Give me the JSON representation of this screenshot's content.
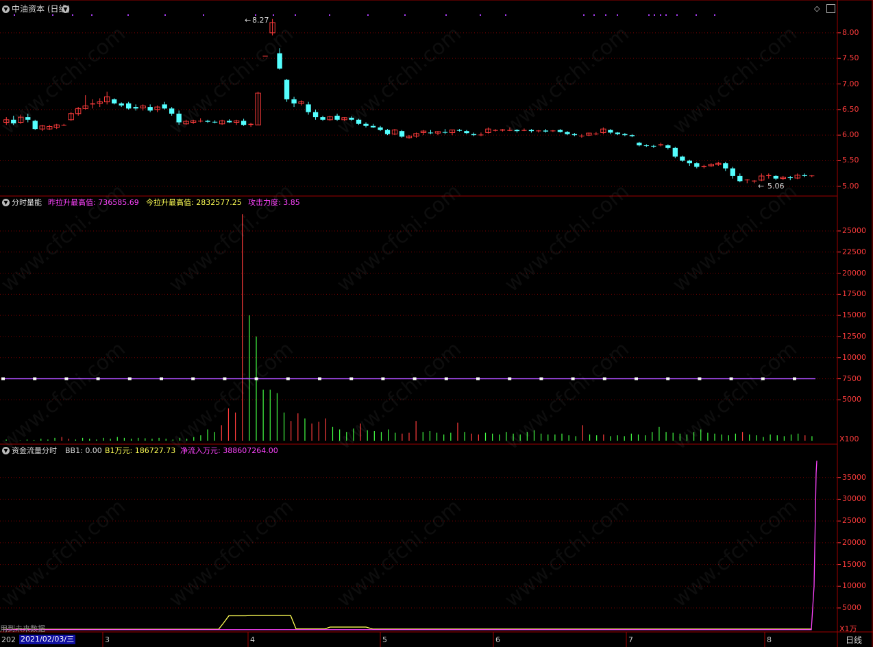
{
  "colors": {
    "up": "#ff3c3c",
    "down": "#54ffff",
    "grid": "#7a0000",
    "frame": "#a00000",
    "axis": "#ff3c3c",
    "magenta": "#ff44ff",
    "yellow": "#ffff55",
    "white": "#ffffff",
    "bg": "#000000"
  },
  "icons": {
    "menu": "chevron-down-icon",
    "diamond": "diamond-icon",
    "maximize": "maximize-icon"
  },
  "panel1": {
    "title": "中油资本 (日线)",
    "high_label": "8.27",
    "low_label": "5.06",
    "yticks": [
      "8.00",
      "7.50",
      "7.00",
      "6.50",
      "6.00",
      "5.50",
      "5.00"
    ]
  },
  "panel2": {
    "name": "分时量能",
    "f1_label": "昨拉升最高值:",
    "f1_value": "736585.69",
    "f2_label": "今拉升最高值:",
    "f2_value": "2832577.25",
    "f3_label": "攻击力度:",
    "f3_value": "3.85",
    "yticks": [
      "25000",
      "22500",
      "20000",
      "17500",
      "15000",
      "12500",
      "10000",
      "7500",
      "5000"
    ],
    "unit": "X100"
  },
  "panel3": {
    "name": "资金流量分时",
    "f1_label": "BB1:",
    "f1_value": "0.00",
    "f2_label": "B1万元:",
    "f2_value": "186727.73",
    "f3_label": "净流入万元:",
    "f3_value": "388607264.00",
    "note": "用到未来数据",
    "yticks": [
      "35000",
      "30000",
      "25000",
      "20000",
      "15000",
      "10000",
      "5000"
    ],
    "unit": "X1万"
  },
  "xaxis": {
    "left_stub": "202",
    "date": "2021/02/03/三",
    "months": [
      "3",
      "4",
      "5",
      "6",
      "7",
      "8"
    ],
    "period": "日线"
  },
  "watermark": "www.cfchi.com",
  "chart_data": [
    {
      "type": "candlestick",
      "title": "中油资本 (日线)",
      "ylim": [
        4.85,
        8.4
      ],
      "yticks": [
        5.0,
        5.5,
        6.0,
        6.5,
        7.0,
        7.5,
        8.0
      ],
      "annotations": [
        {
          "text": "8.27",
          "value": 8.27
        },
        {
          "text": "5.06",
          "value": 5.06
        }
      ],
      "ohlc": [
        [
          6.25,
          6.35,
          6.2,
          6.3
        ],
        [
          6.3,
          6.38,
          6.2,
          6.23
        ],
        [
          6.25,
          6.4,
          6.22,
          6.35
        ],
        [
          6.35,
          6.42,
          6.25,
          6.3
        ],
        [
          6.28,
          6.3,
          6.1,
          6.12
        ],
        [
          6.12,
          6.2,
          6.08,
          6.18
        ],
        [
          6.12,
          6.2,
          6.1,
          6.17
        ],
        [
          6.15,
          6.22,
          6.12,
          6.2
        ],
        [
          6.2,
          6.22,
          6.18,
          6.2
        ],
        [
          6.3,
          6.45,
          6.28,
          6.42
        ],
        [
          6.42,
          6.55,
          6.38,
          6.52
        ],
        [
          6.52,
          6.78,
          6.5,
          6.57
        ],
        [
          6.6,
          6.7,
          6.52,
          6.62
        ],
        [
          6.62,
          6.72,
          6.55,
          6.65
        ],
        [
          6.65,
          6.85,
          6.6,
          6.75
        ],
        [
          6.7,
          6.72,
          6.6,
          6.62
        ],
        [
          6.62,
          6.64,
          6.55,
          6.58
        ],
        [
          6.62,
          6.65,
          6.5,
          6.52
        ],
        [
          6.55,
          6.6,
          6.48,
          6.52
        ],
        [
          6.53,
          6.6,
          6.48,
          6.57
        ],
        [
          6.55,
          6.6,
          6.45,
          6.48
        ],
        [
          6.5,
          6.58,
          6.45,
          6.55
        ],
        [
          6.6,
          6.65,
          6.5,
          6.52
        ],
        [
          6.52,
          6.55,
          6.38,
          6.42
        ],
        [
          6.42,
          6.48,
          6.2,
          6.25
        ],
        [
          6.22,
          6.3,
          6.2,
          6.27
        ],
        [
          6.25,
          6.3,
          6.22,
          6.28
        ],
        [
          6.28,
          6.33,
          6.25,
          6.28
        ],
        [
          6.28,
          6.3,
          6.24,
          6.26
        ],
        [
          6.26,
          6.29,
          6.23,
          6.25
        ],
        [
          6.22,
          6.3,
          6.2,
          6.28
        ],
        [
          6.28,
          6.31,
          6.24,
          6.25
        ],
        [
          6.25,
          6.3,
          6.2,
          6.28
        ],
        [
          6.28,
          6.32,
          6.18,
          6.2
        ],
        [
          6.2,
          6.24,
          6.16,
          6.22
        ],
        [
          6.2,
          6.85,
          6.2,
          6.82
        ],
        [
          7.55,
          7.55,
          7.55,
          7.55
        ],
        [
          8.0,
          8.27,
          7.95,
          8.2
        ],
        [
          7.6,
          7.7,
          7.28,
          7.3
        ],
        [
          7.08,
          7.1,
          6.65,
          6.7
        ],
        [
          6.7,
          6.75,
          6.55,
          6.62
        ],
        [
          6.62,
          6.68,
          6.58,
          6.65
        ],
        [
          6.6,
          6.65,
          6.4,
          6.45
        ],
        [
          6.45,
          6.5,
          6.3,
          6.35
        ],
        [
          6.35,
          6.38,
          6.28,
          6.3
        ],
        [
          6.3,
          6.38,
          6.28,
          6.36
        ],
        [
          6.38,
          6.42,
          6.28,
          6.3
        ],
        [
          6.3,
          6.35,
          6.28,
          6.34
        ],
        [
          6.34,
          6.37,
          6.28,
          6.3
        ],
        [
          6.3,
          6.32,
          6.2,
          6.22
        ],
        [
          6.22,
          6.25,
          6.15,
          6.18
        ],
        [
          6.18,
          6.22,
          6.14,
          6.15
        ],
        [
          6.15,
          6.18,
          6.08,
          6.1
        ],
        [
          6.1,
          6.12,
          6.0,
          6.02
        ],
        [
          6.02,
          6.12,
          6.0,
          6.1
        ],
        [
          6.08,
          6.1,
          5.95,
          5.97
        ],
        [
          5.95,
          6.0,
          5.93,
          5.98
        ],
        [
          5.98,
          6.05,
          5.95,
          6.03
        ],
        [
          6.05,
          6.1,
          6.0,
          6.08
        ],
        [
          6.05,
          6.1,
          6.02,
          6.04
        ],
        [
          6.04,
          6.08,
          6.0,
          6.07
        ],
        [
          6.06,
          6.12,
          6.02,
          6.05
        ],
        [
          6.05,
          6.1,
          6.0,
          6.1
        ],
        [
          6.1,
          6.12,
          6.07,
          6.09
        ],
        [
          6.08,
          6.1,
          6.02,
          6.04
        ],
        [
          6.02,
          6.05,
          5.98,
          6.0
        ],
        [
          6.0,
          6.05,
          5.98,
          6.01
        ],
        [
          6.05,
          6.15,
          6.03,
          6.12
        ],
        [
          6.1,
          6.12,
          6.07,
          6.1
        ],
        [
          6.09,
          6.12,
          6.07,
          6.11
        ],
        [
          6.1,
          6.15,
          6.08,
          6.1
        ],
        [
          6.1,
          6.12,
          6.05,
          6.08
        ],
        [
          6.1,
          6.13,
          6.08,
          6.1
        ],
        [
          6.1,
          6.12,
          6.05,
          6.08
        ],
        [
          6.08,
          6.1,
          6.05,
          6.09
        ],
        [
          6.09,
          6.12,
          6.05,
          6.07
        ],
        [
          6.08,
          6.1,
          6.06,
          6.09
        ],
        [
          6.1,
          6.12,
          6.05,
          6.06
        ],
        [
          6.06,
          6.08,
          6.0,
          6.02
        ],
        [
          6.02,
          6.04,
          5.98,
          6.0
        ],
        [
          5.98,
          6.02,
          5.95,
          5.99
        ],
        [
          6.0,
          6.05,
          5.98,
          6.04
        ],
        [
          6.02,
          6.06,
          6.0,
          6.03
        ],
        [
          6.05,
          6.15,
          6.02,
          6.12
        ],
        [
          6.1,
          6.12,
          6.02,
          6.05
        ],
        [
          6.05,
          6.06,
          6.0,
          6.02
        ],
        [
          6.02,
          6.04,
          5.98,
          6.0
        ],
        [
          6.0,
          6.02,
          5.96,
          5.98
        ],
        [
          5.85,
          5.87,
          5.78,
          5.8
        ],
        [
          5.8,
          5.82,
          5.77,
          5.79
        ],
        [
          5.79,
          5.81,
          5.75,
          5.78
        ],
        [
          5.8,
          5.85,
          5.78,
          5.82
        ],
        [
          5.8,
          5.82,
          5.72,
          5.75
        ],
        [
          5.75,
          5.77,
          5.55,
          5.58
        ],
        [
          5.58,
          5.6,
          5.48,
          5.5
        ],
        [
          5.5,
          5.52,
          5.4,
          5.45
        ],
        [
          5.45,
          5.47,
          5.35,
          5.38
        ],
        [
          5.38,
          5.42,
          5.35,
          5.4
        ],
        [
          5.4,
          5.45,
          5.38,
          5.43
        ],
        [
          5.42,
          5.48,
          5.4,
          5.45
        ],
        [
          5.45,
          5.48,
          5.3,
          5.35
        ],
        [
          5.35,
          5.38,
          5.15,
          5.2
        ],
        [
          5.2,
          5.25,
          5.08,
          5.1
        ],
        [
          5.12,
          5.14,
          5.06,
          5.13
        ],
        [
          5.1,
          5.12,
          5.06,
          5.11
        ],
        [
          5.12,
          5.25,
          5.1,
          5.2
        ],
        [
          5.2,
          5.25,
          5.15,
          5.22
        ],
        [
          5.2,
          5.22,
          5.12,
          5.15
        ],
        [
          5.15,
          5.2,
          5.12,
          5.18
        ],
        [
          5.18,
          5.2,
          5.12,
          5.16
        ],
        [
          5.16,
          5.25,
          5.14,
          5.22
        ],
        [
          5.22,
          5.25,
          5.18,
          5.2
        ],
        [
          5.2,
          5.22,
          5.18,
          5.21
        ]
      ]
    },
    {
      "type": "bar",
      "title": "分时量能",
      "ylim": [
        0,
        28000
      ],
      "yticks": [
        5000,
        7500,
        10000,
        12500,
        15000,
        17500,
        20000,
        22500,
        25000
      ],
      "reference_line": 7500,
      "unit": "X100",
      "bars": [
        [
          300,
          "g"
        ],
        [
          150,
          "g"
        ],
        [
          200,
          "g"
        ],
        [
          300,
          "g"
        ],
        [
          250,
          "g"
        ],
        [
          400,
          "g"
        ],
        [
          300,
          "g"
        ],
        [
          500,
          "g"
        ],
        [
          600,
          "r"
        ],
        [
          400,
          "r"
        ],
        [
          300,
          "g"
        ],
        [
          500,
          "g"
        ],
        [
          400,
          "g"
        ],
        [
          300,
          "g"
        ],
        [
          500,
          "g"
        ],
        [
          400,
          "g"
        ],
        [
          600,
          "g"
        ],
        [
          500,
          "g"
        ],
        [
          400,
          "g"
        ],
        [
          500,
          "g"
        ],
        [
          450,
          "g"
        ],
        [
          400,
          "g"
        ],
        [
          500,
          "g"
        ],
        [
          400,
          "g"
        ],
        [
          300,
          "g"
        ],
        [
          500,
          "g"
        ],
        [
          400,
          "g"
        ],
        [
          600,
          "g"
        ],
        [
          800,
          "g"
        ],
        [
          1500,
          "g"
        ],
        [
          1200,
          "g"
        ],
        [
          2000,
          "r"
        ],
        [
          4000,
          "r"
        ],
        [
          3500,
          "r"
        ],
        [
          27000,
          "r"
        ],
        [
          15000,
          "g"
        ],
        [
          12500,
          "g"
        ],
        [
          6200,
          "g"
        ],
        [
          6200,
          "g"
        ],
        [
          5800,
          "g"
        ],
        [
          3500,
          "g"
        ],
        [
          2500,
          "r"
        ],
        [
          3400,
          "r"
        ],
        [
          2800,
          "g"
        ],
        [
          2200,
          "r"
        ],
        [
          2400,
          "r"
        ],
        [
          2800,
          "r"
        ],
        [
          1800,
          "g"
        ],
        [
          1500,
          "g"
        ],
        [
          1200,
          "g"
        ],
        [
          1600,
          "g"
        ],
        [
          2200,
          "r"
        ],
        [
          1400,
          "g"
        ],
        [
          1300,
          "g"
        ],
        [
          1200,
          "g"
        ],
        [
          1500,
          "g"
        ],
        [
          1100,
          "g"
        ],
        [
          1000,
          "r"
        ],
        [
          1100,
          "r"
        ],
        [
          2500,
          "r"
        ],
        [
          1200,
          "g"
        ],
        [
          1300,
          "g"
        ],
        [
          1100,
          "g"
        ],
        [
          900,
          "g"
        ],
        [
          1100,
          "g"
        ],
        [
          2300,
          "r"
        ],
        [
          1200,
          "g"
        ],
        [
          1000,
          "r"
        ],
        [
          900,
          "r"
        ],
        [
          1100,
          "g"
        ],
        [
          1000,
          "g"
        ],
        [
          900,
          "g"
        ],
        [
          1200,
          "g"
        ],
        [
          1000,
          "g"
        ],
        [
          900,
          "g"
        ],
        [
          1200,
          "g"
        ],
        [
          1400,
          "g"
        ],
        [
          1000,
          "g"
        ],
        [
          900,
          "g"
        ],
        [
          900,
          "g"
        ],
        [
          1000,
          "g"
        ],
        [
          800,
          "g"
        ],
        [
          700,
          "g"
        ],
        [
          2000,
          "r"
        ],
        [
          900,
          "g"
        ],
        [
          800,
          "g"
        ],
        [
          900,
          "r"
        ],
        [
          700,
          "g"
        ],
        [
          800,
          "g"
        ],
        [
          700,
          "g"
        ],
        [
          1000,
          "g"
        ],
        [
          900,
          "g"
        ],
        [
          800,
          "g"
        ],
        [
          1200,
          "g"
        ],
        [
          1800,
          "g"
        ],
        [
          1200,
          "g"
        ],
        [
          1100,
          "g"
        ],
        [
          1000,
          "g"
        ],
        [
          900,
          "g"
        ],
        [
          1200,
          "g"
        ],
        [
          1500,
          "g"
        ],
        [
          1100,
          "g"
        ],
        [
          1000,
          "g"
        ],
        [
          900,
          "g"
        ],
        [
          800,
          "g"
        ],
        [
          1000,
          "g"
        ],
        [
          1200,
          "r"
        ],
        [
          900,
          "g"
        ],
        [
          800,
          "g"
        ],
        [
          600,
          "g"
        ],
        [
          900,
          "g"
        ],
        [
          800,
          "g"
        ],
        [
          700,
          "g"
        ],
        [
          900,
          "g"
        ],
        [
          1000,
          "g"
        ],
        [
          800,
          "r"
        ],
        [
          700,
          "g"
        ]
      ]
    },
    {
      "type": "line",
      "title": "资金流量分时",
      "ylim": [
        -200,
        40000
      ],
      "yticks": [
        5000,
        10000,
        15000,
        20000,
        25000,
        30000,
        35000
      ],
      "unit": "X1万",
      "series": [
        {
          "color": "#ffff55",
          "values": [
            [
              0,
              100
            ],
            [
              315,
              100
            ],
            [
              322,
              1500
            ],
            [
              330,
              3200
            ],
            [
              355,
              3200
            ],
            [
              362,
              3300
            ],
            [
              420,
              3300
            ],
            [
              428,
              200
            ],
            [
              470,
              200
            ],
            [
              478,
              600
            ],
            [
              530,
              600
            ],
            [
              540,
              150
            ],
            [
              1180,
              150
            ]
          ]
        },
        {
          "color": "#ff44ff",
          "values": [
            [
              0,
              0
            ],
            [
              1180,
              0
            ],
            [
              1184,
              10000
            ],
            [
              1187,
              36000
            ],
            [
              1188,
              38860
            ]
          ]
        }
      ]
    }
  ]
}
